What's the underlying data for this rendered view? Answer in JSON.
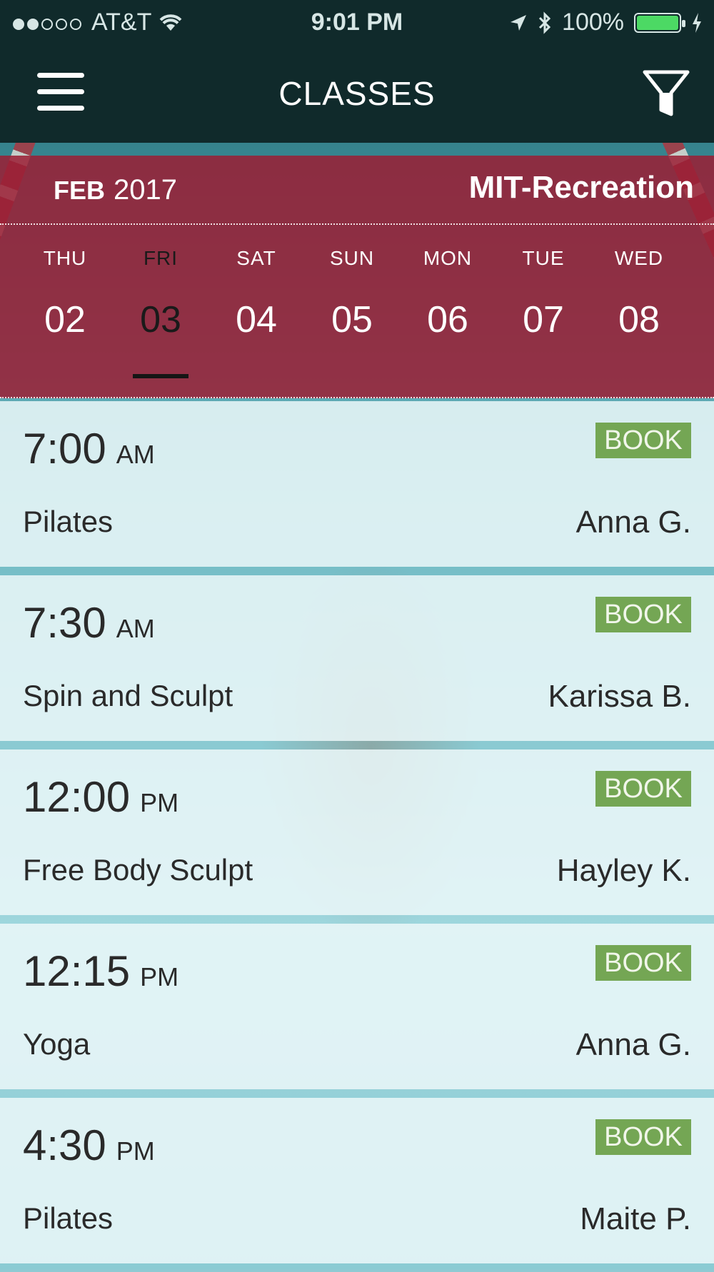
{
  "status_bar": {
    "carrier": "AT&T",
    "time": "9:01 PM",
    "battery": "100%",
    "signal_bars_filled": 2,
    "signal_bars_total": 5,
    "battery_color": "#4cd964"
  },
  "nav": {
    "title": "CLASSES",
    "menu_icon": "hamburger-icon",
    "filter_icon": "filter-icon"
  },
  "calendar": {
    "month": "FEB",
    "year": "2017",
    "location": "MIT-Recreation",
    "days": [
      {
        "dow": "THU",
        "num": "02",
        "selected": false
      },
      {
        "dow": "FRI",
        "num": "03",
        "selected": true
      },
      {
        "dow": "SAT",
        "num": "04",
        "selected": false
      },
      {
        "dow": "SUN",
        "num": "05",
        "selected": false
      },
      {
        "dow": "MON",
        "num": "06",
        "selected": false
      },
      {
        "dow": "TUE",
        "num": "07",
        "selected": false
      },
      {
        "dow": "WED",
        "num": "08",
        "selected": false
      }
    ],
    "banner_color": "#9b1e34"
  },
  "classes": [
    {
      "time": "7:00",
      "ampm": "AM",
      "name": "Pilates",
      "instructor": "Anna G.",
      "action": "BOOK"
    },
    {
      "time": "7:30",
      "ampm": "AM",
      "name": "Spin and Sculpt",
      "instructor": "Karissa B.",
      "action": "BOOK"
    },
    {
      "time": "12:00",
      "ampm": "PM",
      "name": "Free Body Sculpt",
      "instructor": "Hayley K.",
      "action": "BOOK"
    },
    {
      "time": "12:15",
      "ampm": "PM",
      "name": "Yoga",
      "instructor": "Anna G.",
      "action": "BOOK"
    },
    {
      "time": "4:30",
      "ampm": "PM",
      "name": "Pilates",
      "instructor": "Maite P.",
      "action": "BOOK"
    }
  ],
  "colors": {
    "nav_bg": "#102a2b",
    "book_button": "#74a654"
  }
}
